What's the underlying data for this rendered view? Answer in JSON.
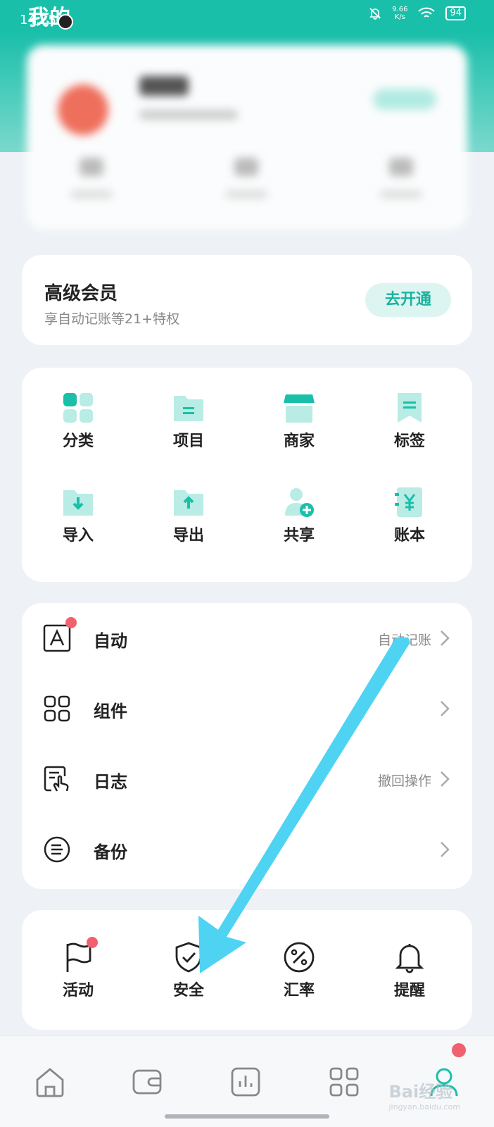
{
  "status_bar": {
    "page_title": "我的",
    "time": "14:25",
    "net_speed_value": "9.66",
    "net_speed_unit": "K/s",
    "battery": "94"
  },
  "vip": {
    "title": "高级会员",
    "subtitle": "享自动记账等21+特权",
    "button": "去开通"
  },
  "features": [
    {
      "label": "分类",
      "icon": "category-icon"
    },
    {
      "label": "项目",
      "icon": "folder-project-icon"
    },
    {
      "label": "商家",
      "icon": "store-icon"
    },
    {
      "label": "标签",
      "icon": "bookmark-tag-icon"
    },
    {
      "label": "导入",
      "icon": "folder-import-icon"
    },
    {
      "label": "导出",
      "icon": "folder-export-icon"
    },
    {
      "label": "共享",
      "icon": "share-user-icon"
    },
    {
      "label": "账本",
      "icon": "ledger-book-icon"
    }
  ],
  "menu": [
    {
      "label": "自动",
      "detail": "自动记账",
      "icon": "auto-a-icon",
      "badge": true
    },
    {
      "label": "组件",
      "detail": "",
      "icon": "widgets-grid-icon",
      "badge": false
    },
    {
      "label": "日志",
      "detail": "撤回操作",
      "icon": "log-touch-icon",
      "badge": false
    },
    {
      "label": "备份",
      "detail": "",
      "icon": "backup-icon",
      "badge": false
    }
  ],
  "tools": [
    {
      "label": "活动",
      "icon": "flag-icon",
      "badge": true
    },
    {
      "label": "安全",
      "icon": "shield-check-icon",
      "badge": false
    },
    {
      "label": "汇率",
      "icon": "percent-icon",
      "badge": false
    },
    {
      "label": "提醒",
      "icon": "bell-icon",
      "badge": false
    }
  ],
  "tabs": [
    {
      "icon": "home-icon",
      "active": false
    },
    {
      "icon": "wallet-icon",
      "active": false
    },
    {
      "icon": "chart-icon",
      "active": false
    },
    {
      "icon": "apps-grid-icon",
      "active": false
    },
    {
      "icon": "profile-icon",
      "active": true,
      "badge": true
    }
  ],
  "watermark": {
    "brand": "Bai经验",
    "url": "jingyan.baidu.com"
  },
  "colors": {
    "brand": "#1abfaa",
    "accent_light": "#b8ece4",
    "badge": "#f0606e",
    "arrow": "#4fd3f2"
  }
}
